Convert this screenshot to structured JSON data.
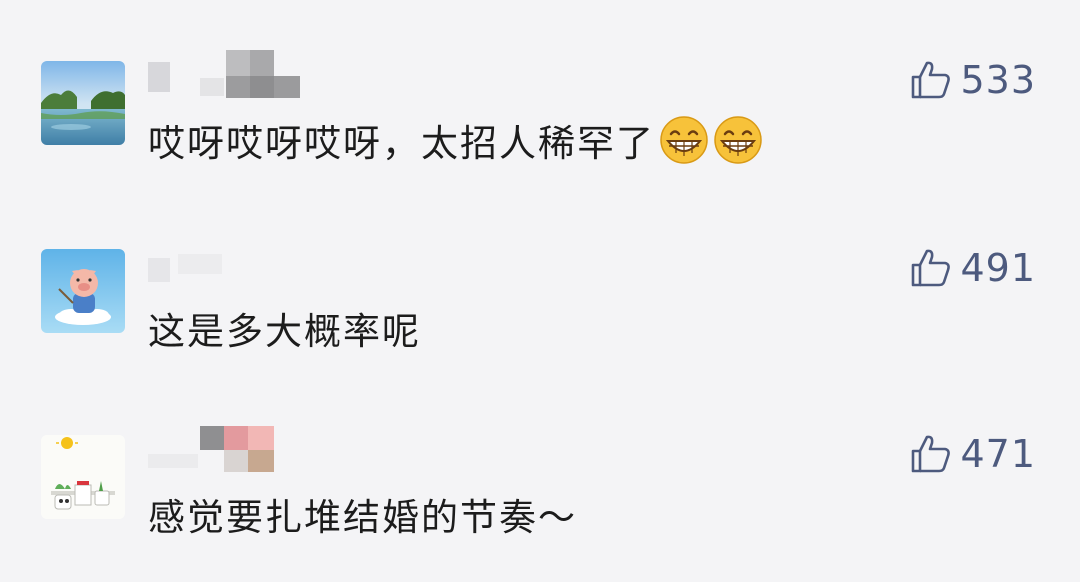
{
  "comments": [
    {
      "text": "哎呀哎呀哎呀，太招人稀罕了",
      "likes": "533",
      "emojis": [
        "grinning-face-icon",
        "grinning-face-icon"
      ]
    },
    {
      "text": "这是多大概率呢",
      "likes": "491",
      "emojis": []
    },
    {
      "text": "感觉要扎堆结婚的节奏～",
      "likes": "471",
      "emojis": []
    }
  ],
  "colors": {
    "background": "#f4f4f6",
    "like_accent": "#4d5a7e",
    "text": "#1c1c1c"
  }
}
